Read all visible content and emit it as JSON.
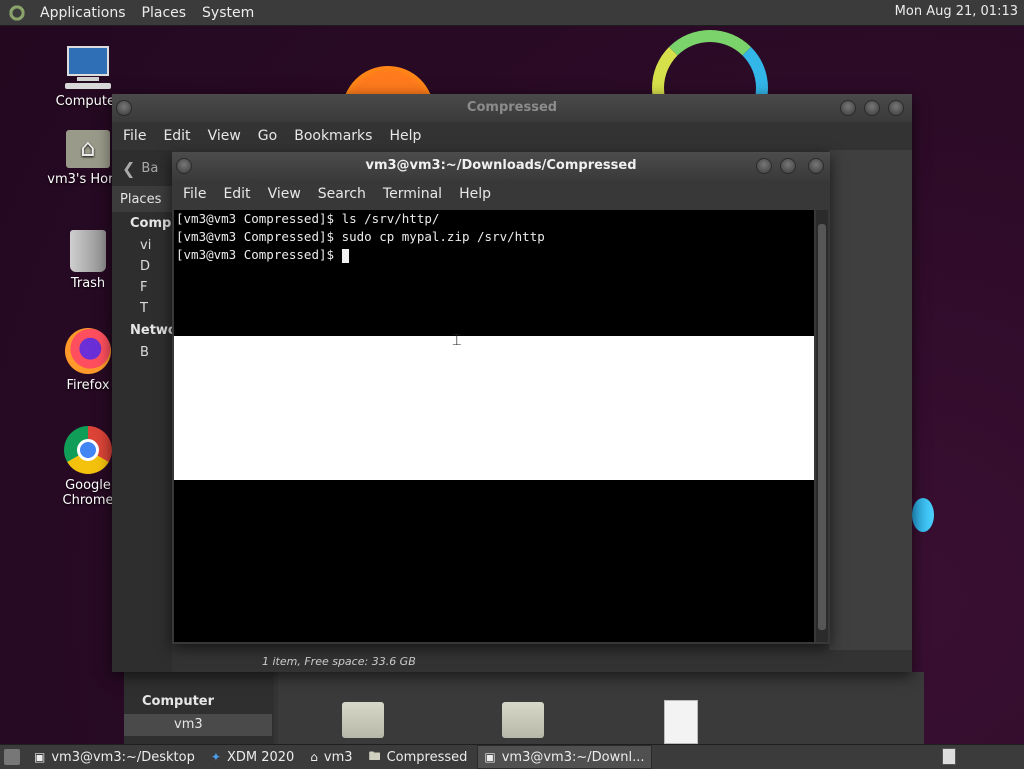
{
  "top_panel": {
    "menus": [
      "Applications",
      "Places",
      "System"
    ],
    "clock": "Mon Aug 21, 01:13"
  },
  "desktop_icons": [
    {
      "label": "Computer",
      "icon": "computer-icon"
    },
    {
      "label": "vm3's Home",
      "icon": "home-folder-icon"
    },
    {
      "label": "Trash",
      "icon": "trash-icon"
    },
    {
      "label": "Firefox",
      "icon": "firefox-icon"
    },
    {
      "label": "Google Chrome",
      "icon": "chrome-icon"
    }
  ],
  "file_manager": {
    "title": "Compressed",
    "menu": [
      "File",
      "Edit",
      "View",
      "Go",
      "Bookmarks",
      "Help"
    ],
    "back_label": "Ba",
    "places_header": "Places",
    "sections": {
      "computer": "Compu",
      "network": "Netwo"
    },
    "items": [
      "vi",
      "D",
      "F",
      "T",
      "B"
    ],
    "status": "1 item, Free space: 33.6 GB"
  },
  "file_manager_low": {
    "places_header": "Places",
    "section": "Computer",
    "selected_item": "vm3",
    "path": "vm3"
  },
  "terminal": {
    "title": "vm3@vm3:~/Downloads/Compressed",
    "menu": [
      "File",
      "Edit",
      "View",
      "Search",
      "Terminal",
      "Help"
    ],
    "lines": [
      "[vm3@vm3 Compressed]$ ls /srv/http/",
      "[vm3@vm3 Compressed]$ sudo cp mypal.zip /srv/http",
      "[vm3@vm3 Compressed]$ "
    ]
  },
  "taskbar": {
    "tasks": [
      {
        "label": "vm3@vm3:~/Desktop",
        "icon": "terminal-icon",
        "active": false
      },
      {
        "label": "XDM 2020",
        "icon": "xdm-icon",
        "active": false
      },
      {
        "label": "vm3",
        "icon": "home-folder-icon",
        "active": false
      },
      {
        "label": "Compressed",
        "icon": "folder-icon",
        "active": false
      },
      {
        "label": "vm3@vm3:~/Downl...",
        "icon": "terminal-icon",
        "active": true
      }
    ]
  }
}
